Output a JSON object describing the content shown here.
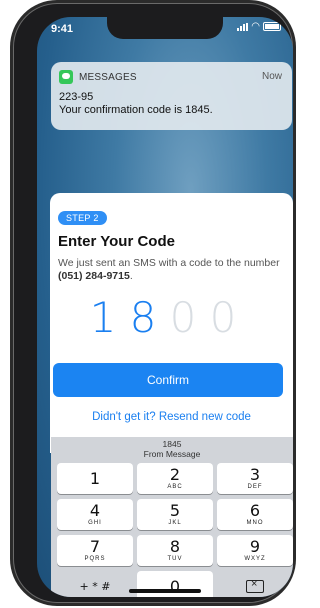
{
  "status": {
    "time": "9:41"
  },
  "notification": {
    "app": "MESSAGES",
    "time": "Now",
    "title": "223-95",
    "body": "Your confirmation code is 1845."
  },
  "card": {
    "step": "STEP 2",
    "title": "Enter Your Code",
    "desc_prefix": "We just sent an SMS with a code to the number",
    "phone": "(051) 284-9715",
    "desc_suffix": ".",
    "digits": [
      "1",
      "8",
      "0",
      "0"
    ],
    "confirm_label": "Confirm",
    "resend_label": "Didn't get it? Resend new code"
  },
  "keyboard": {
    "suggestion_code": "1845",
    "suggestion_source": "From Message",
    "keys": [
      {
        "n": "1",
        "l": ""
      },
      {
        "n": "2",
        "l": "ABC"
      },
      {
        "n": "3",
        "l": "DEF"
      },
      {
        "n": "4",
        "l": "GHI"
      },
      {
        "n": "5",
        "l": "JKL"
      },
      {
        "n": "6",
        "l": "MNO"
      },
      {
        "n": "7",
        "l": "PQRS"
      },
      {
        "n": "8",
        "l": "TUV"
      },
      {
        "n": "9",
        "l": "WXYZ"
      },
      {
        "n": "+ * #",
        "l": ""
      },
      {
        "n": "0",
        "l": ""
      }
    ]
  },
  "colors": {
    "accent": "#1b84f2",
    "notif_icon": "#34c759"
  },
  "icons": [
    "signal-icon",
    "wifi-icon",
    "battery-icon",
    "messages-app-icon",
    "delete-icon"
  ]
}
